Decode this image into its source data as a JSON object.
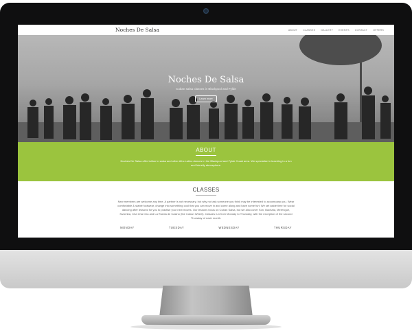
{
  "site": {
    "brand": "Noches De Salsa",
    "nav": [
      "ABOUT",
      "CLASSES",
      "GALLERY",
      "EVENTS",
      "CONTACT",
      "OFFERS"
    ]
  },
  "hero": {
    "title": "Noches De Salsa",
    "subtitle": "Cuban salsa classes in Blackpool and Fylde",
    "button": "Learn more"
  },
  "about": {
    "heading": "ABOUT",
    "text": "Noches De Salsa offer tuition in salsa and other Afro-Latino dances in the Blackpool and Fylde Coast area. We specialise in teaching in a fun and friendly atmosphere."
  },
  "classes": {
    "heading": "CLASSES",
    "text": "New members are welcome any time. A partner is not necessary, but why not ask someone you think may be interested to accompany you. Wear comfortable & stable footwear, change into something cool that you can move in and come along and have some fun! We set aside time for social dancing after lessons for you to practise your new moves. Our lessons focus on Cuban Salsa, but we also cover Son, Bachata, Merengue, Kizomba, Cha Cha Cha and La Rueda de Casino (the Cuban Wheel). Classes run from Monday to Thursday, with the exception of the second Thursday of each month.",
    "days": [
      "MONDAY",
      "TUESDAY",
      "WEDNESDAY",
      "THURSDAY"
    ]
  },
  "colors": {
    "accent": "#9bc43e",
    "monitor_frame": "#0f0f10",
    "monitor_chin": "#d4d4d4"
  }
}
